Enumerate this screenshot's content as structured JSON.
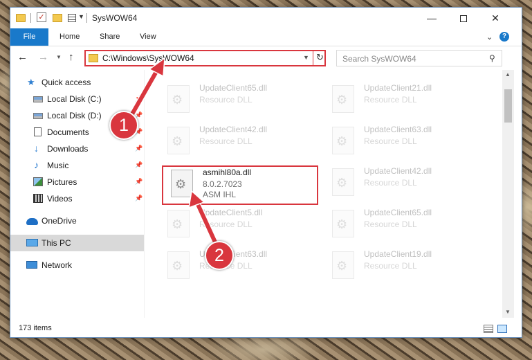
{
  "window": {
    "title": "SysWOW64"
  },
  "ribbon": {
    "tabs": [
      "File",
      "Home",
      "Share",
      "View"
    ]
  },
  "address": {
    "path": "C:\\Windows\\SysWOW64",
    "search_placeholder": "Search SysWOW64"
  },
  "nav_pane": {
    "items": [
      {
        "label": "Quick access",
        "icon": "star-icon",
        "pinned": false
      },
      {
        "label": "Local Disk (C:)",
        "icon": "drive-icon",
        "pinned": true
      },
      {
        "label": "Local Disk (D:)",
        "icon": "drive-icon",
        "pinned": true
      },
      {
        "label": "Documents",
        "icon": "documents-icon",
        "pinned": true
      },
      {
        "label": "Downloads",
        "icon": "download-icon",
        "pinned": true
      },
      {
        "label": "Music",
        "icon": "music-icon",
        "pinned": true
      },
      {
        "label": "Pictures",
        "icon": "pictures-icon",
        "pinned": true
      },
      {
        "label": "Videos",
        "icon": "videos-icon",
        "pinned": true
      },
      {
        "label": "OneDrive",
        "icon": "onedrive-icon",
        "pinned": false
      },
      {
        "label": "This PC",
        "icon": "this-pc-icon",
        "pinned": false,
        "selected": true
      },
      {
        "label": "Network",
        "icon": "network-icon",
        "pinned": false
      }
    ]
  },
  "files": [
    {
      "name": "UpdateClient65.dll",
      "line2": "Resource DLL",
      "line3": "",
      "faded": true
    },
    {
      "name": "UpdateClient21.dll",
      "line2": "Resource DLL",
      "line3": "",
      "faded": true
    },
    {
      "name": "UpdateClient42.dll",
      "line2": "Resource DLL",
      "line3": "",
      "faded": true
    },
    {
      "name": "UpdateClient63.dll",
      "line2": "Resource DLL",
      "line3": "",
      "faded": true
    },
    {
      "name": "asmihl80a.dll",
      "line2": "8.0.2.7023",
      "line3": "ASM IHL",
      "faded": false,
      "highlighted": true
    },
    {
      "name": "UpdateClient42.dll",
      "line2": "Resource DLL",
      "line3": "",
      "faded": true
    },
    {
      "name": "UpdateClient5.dll",
      "line2": "Resource DLL",
      "line3": "",
      "faded": true
    },
    {
      "name": "UpdateClient65.dll",
      "line2": "Resource DLL",
      "line3": "",
      "faded": true
    },
    {
      "name": "UpdateClient63.dll",
      "line2": "Resource DLL",
      "line3": "",
      "faded": true
    },
    {
      "name": "UpdateClient19.dll",
      "line2": "Resource DLL",
      "line3": "",
      "faded": true
    }
  ],
  "status": {
    "item_count": "173 items"
  },
  "annotations": {
    "step1": "1",
    "step2": "2",
    "color": "#d9363e"
  }
}
